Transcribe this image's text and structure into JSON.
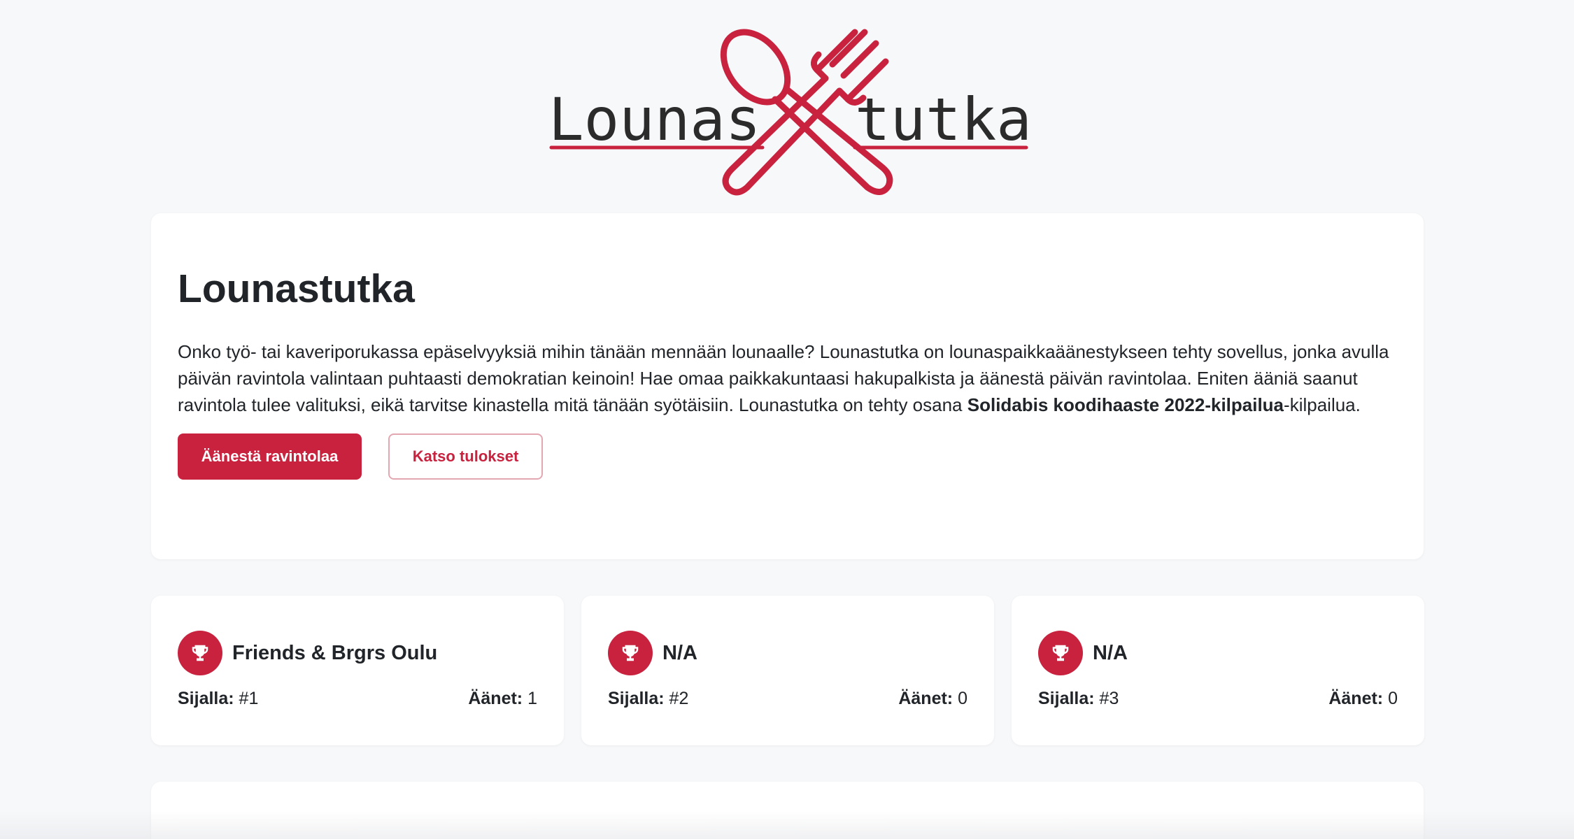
{
  "brand": {
    "logo_text_left": "Lounas",
    "logo_text_right": "tutka",
    "accent_color": "#c8223f"
  },
  "hero": {
    "title": "Lounastutka",
    "description_pre": "Onko työ- tai kaveriporukassa epäselvyyksiä mihin tänään mennään lounaalle? Lounastutka on lounaspaikkaäänestykseen tehty sovellus, jonka avulla päivän ravintola valintaan puhtaasti demokratian keinoin! Hae omaa paikkakuntaasi hakupalkista ja äänestä päivän ravintolaa. Eniten ääniä saanut ravintola tulee valituksi, eikä tarvitse kinastella mitä tänään syötäisiin. Lounastutka on tehty osana ",
    "description_bold": "Solidabis koodihaaste 2022-kilpailua",
    "description_post": "-kilpailua.",
    "vote_button_label": "Äänestä ravintolaa",
    "results_button_label": "Katso tulokset"
  },
  "results": [
    {
      "icon": "trophy-icon",
      "name": "Friends & Brgrs Oulu",
      "rank_label": "Sijalla:",
      "rank_value": "#1",
      "votes_label": "Äänet:",
      "votes_value": "1"
    },
    {
      "icon": "trophy-icon",
      "name": "N/A",
      "rank_label": "Sijalla:",
      "rank_value": "#2",
      "votes_label": "Äänet:",
      "votes_value": "0"
    },
    {
      "icon": "trophy-icon",
      "name": "N/A",
      "rank_label": "Sijalla:",
      "rank_value": "#3",
      "votes_label": "Äänet:",
      "votes_value": "0"
    }
  ]
}
